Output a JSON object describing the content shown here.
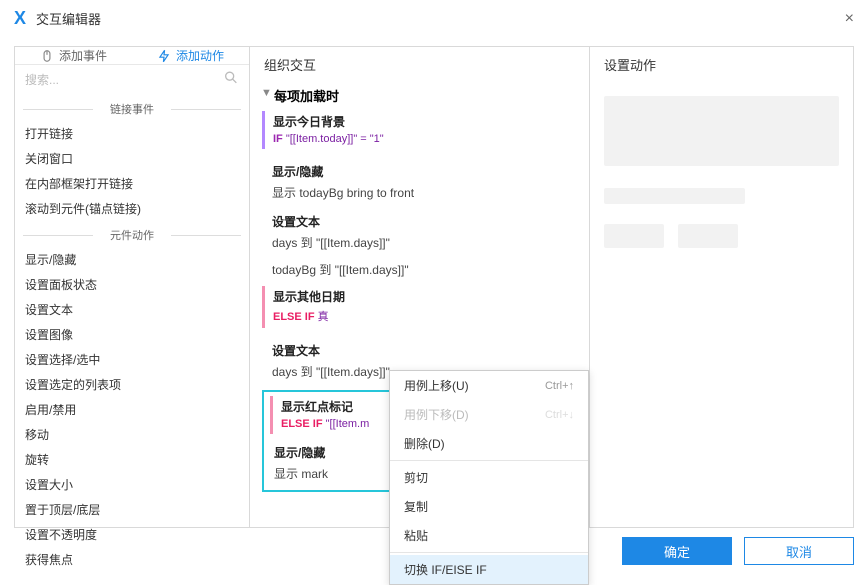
{
  "window": {
    "title": "交互编辑器",
    "close_icon": "×"
  },
  "tabs": {
    "add_event": "添加事件",
    "add_action": "添加动作"
  },
  "search": {
    "placeholder": "搜索..."
  },
  "sections": {
    "link_events": "链接事件",
    "widget_actions": "元件动作"
  },
  "link_actions": [
    "打开链接",
    "关闭窗口",
    "在内部框架打开链接",
    "滚动到元件(锚点链接)"
  ],
  "widget_actions": [
    "显示/隐藏",
    "设置面板状态",
    "设置文本",
    "设置图像",
    "设置选择/选中",
    "设置选定的列表项",
    "启用/禁用",
    "移动",
    "旋转",
    "设置大小",
    "置于顶层/底层",
    "设置不透明度",
    "获得焦点"
  ],
  "mid": {
    "title": "组织交互",
    "root_event": "每项加载时",
    "cases": [
      {
        "color": "purple",
        "title": "显示今日背景",
        "cond_kw": "IF",
        "cond_text": "\"[[Item.today]]\" = \"1\""
      }
    ],
    "acts": [
      {
        "title": "显示/隐藏",
        "line": "显示 todayBg  bring to front"
      },
      {
        "title": "设置文本",
        "line": "days 到 \"[[Item.days]]\""
      },
      {
        "title": "",
        "line": "todayBg 到 \"[[Item.days]]\""
      }
    ],
    "case2": {
      "title": "显示其他日期",
      "cond_kw": "ELSE IF",
      "cond_text": "真"
    },
    "acts2": [
      {
        "title": "设置文本",
        "line": "days 到 \"[[Item.days]]\""
      }
    ],
    "selected": {
      "case_title": "显示红点标记",
      "cond_kw": "ELSE IF",
      "cond_text": "\"[[Item.m",
      "act_title": "显示/隐藏",
      "act_line": "显示 mark"
    }
  },
  "context_menu": {
    "items": [
      {
        "label": "用例上移(U)",
        "shortcut": "Ctrl+↑",
        "disabled": false
      },
      {
        "label": "用例下移(D)",
        "shortcut": "Ctrl+↓",
        "disabled": true
      },
      {
        "label": "删除(D)",
        "shortcut": "",
        "disabled": false
      },
      {
        "sep": true
      },
      {
        "label": "剪切",
        "shortcut": "",
        "disabled": false
      },
      {
        "label": "复制",
        "shortcut": "",
        "disabled": false
      },
      {
        "label": "粘贴",
        "shortcut": "",
        "disabled": false
      },
      {
        "sep": true
      },
      {
        "label": "切换 IF/EISE IF",
        "shortcut": "",
        "highlight": true
      }
    ]
  },
  "right": {
    "title": "设置动作"
  },
  "footer": {
    "ok": "确定",
    "cancel": "取消"
  }
}
